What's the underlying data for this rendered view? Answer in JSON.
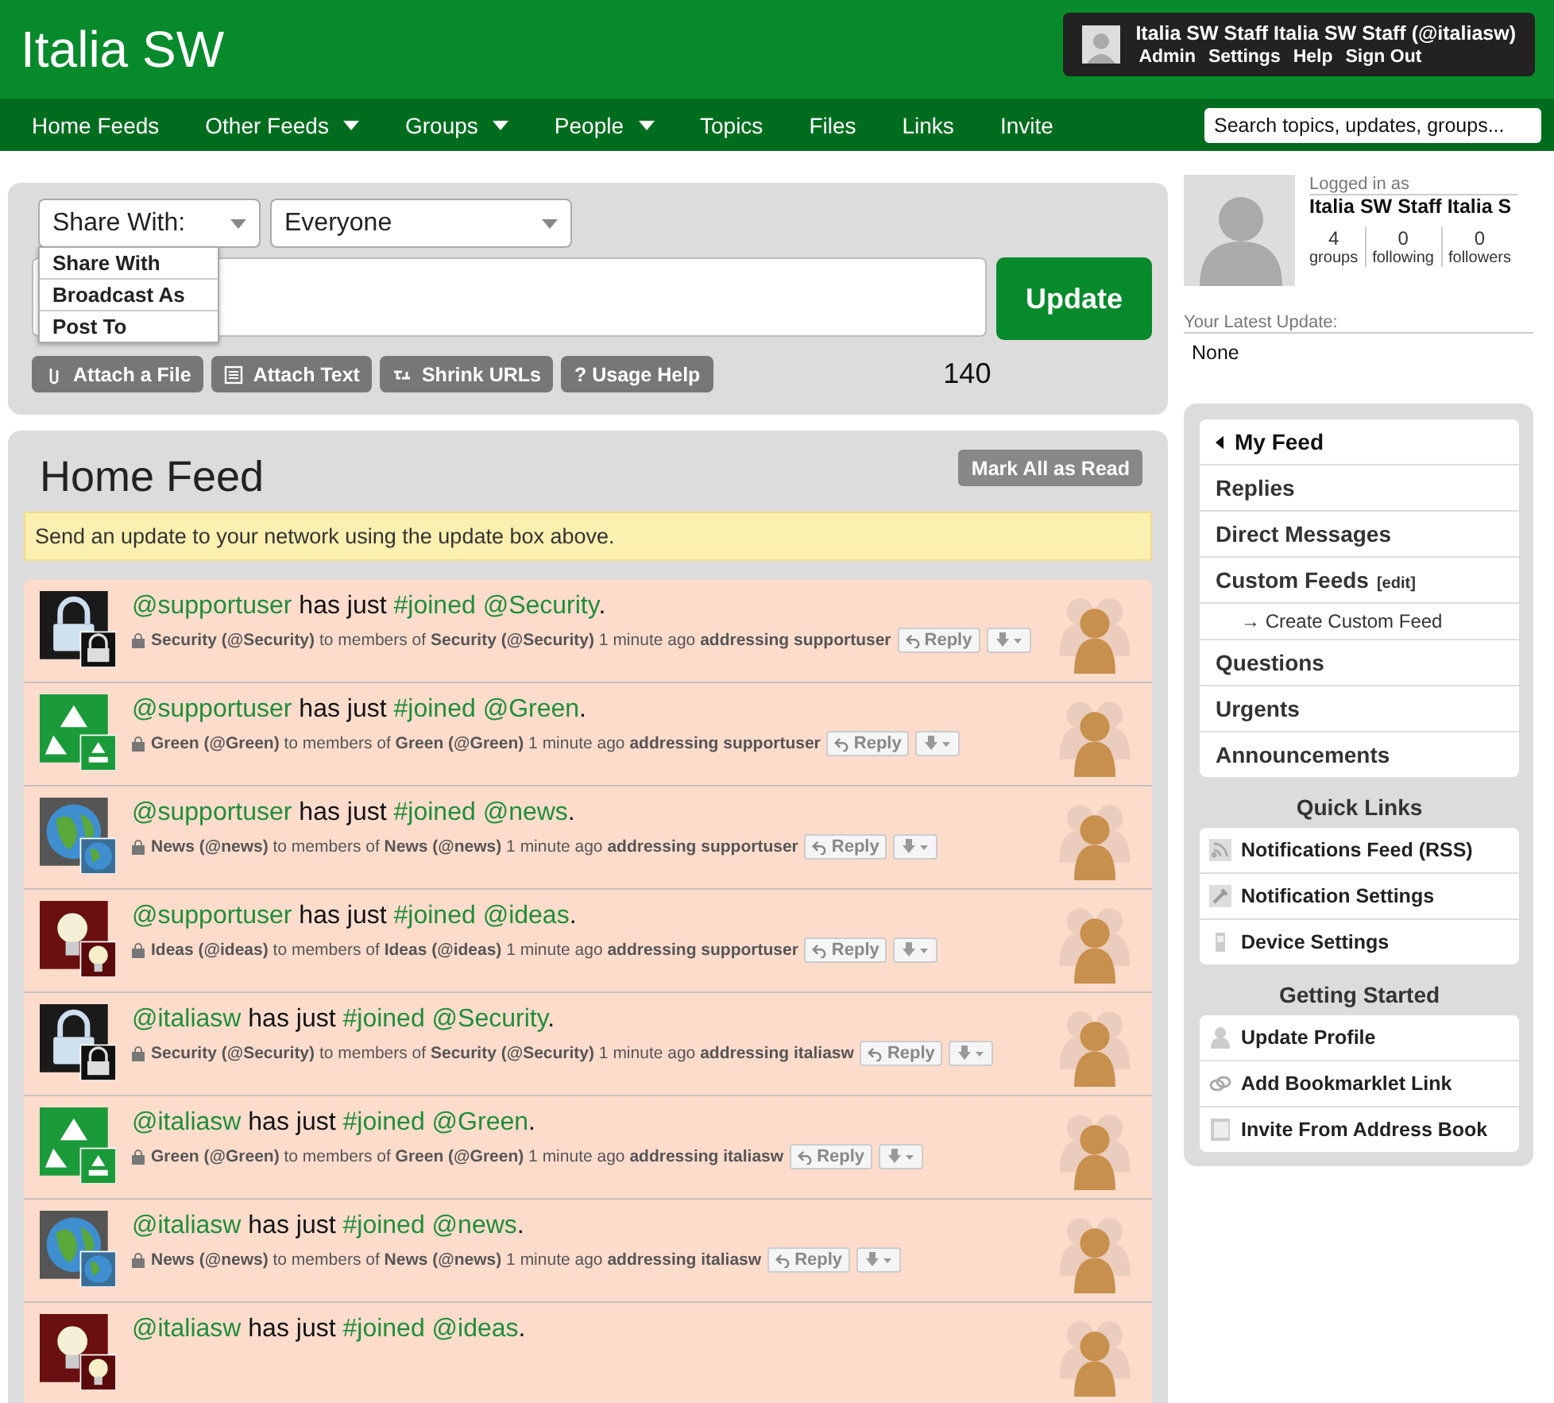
{
  "header": {
    "site_title": "Italia SW",
    "user": {
      "name": "Italia SW Staff Italia SW Staff (@italiasw)",
      "links": [
        "Admin",
        "Settings",
        "Help",
        "Sign Out"
      ]
    }
  },
  "nav": {
    "items": [
      {
        "label": "Home Feeds",
        "has_menu": false
      },
      {
        "label": "Other Feeds",
        "has_menu": true
      },
      {
        "label": "Groups",
        "has_menu": true
      },
      {
        "label": "People",
        "has_menu": true
      },
      {
        "label": "Topics",
        "has_menu": false
      },
      {
        "label": "Files",
        "has_menu": false
      },
      {
        "label": "Links",
        "has_menu": false
      },
      {
        "label": "Invite",
        "has_menu": false
      }
    ],
    "search": {
      "placeholder": "Search topics, updates, groups..."
    }
  },
  "composer": {
    "share_select": "Share With:",
    "audience_select": "Everyone",
    "menu": [
      "Share With",
      "Broadcast As",
      "Post To"
    ],
    "update_button": "Update",
    "tools": [
      {
        "label": "Attach a File",
        "kind": "file"
      },
      {
        "label": "Attach Text",
        "kind": "text"
      },
      {
        "label": "Shrink URLs",
        "kind": "link"
      },
      {
        "label": "? Usage Help",
        "kind": "help"
      }
    ],
    "counter": "140"
  },
  "feed": {
    "title": "Home Feed",
    "mark_read": "Mark All as Read",
    "notice": "Send an update to your network using the update box above.",
    "items": [
      {
        "kind": "security",
        "user": "@supportuser",
        "verb": "has just",
        "tag": "#joined",
        "group": "@Security",
        "end": ".",
        "from": "Security (@Security)",
        "to_prefix": "to members of",
        "to": "Security (@Security)",
        "time": "1 minute ago",
        "addressing": "addressing supportuser",
        "reply": "Reply"
      },
      {
        "kind": "green",
        "user": "@supportuser",
        "verb": "has just",
        "tag": "#joined",
        "group": "@Green",
        "end": ".",
        "from": "Green (@Green)",
        "to_prefix": "to members of",
        "to": "Green (@Green)",
        "time": "1 minute ago",
        "addressing": "addressing supportuser",
        "reply": "Reply"
      },
      {
        "kind": "news",
        "user": "@supportuser",
        "verb": "has just",
        "tag": "#joined",
        "group": "@news",
        "end": ".",
        "from": "News (@news)",
        "to_prefix": "to members of",
        "to": "News (@news)",
        "time": "1 minute ago",
        "addressing": "addressing supportuser",
        "reply": "Reply"
      },
      {
        "kind": "ideas",
        "user": "@supportuser",
        "verb": "has just",
        "tag": "#joined",
        "group": "@ideas",
        "end": ".",
        "from": "Ideas (@ideas)",
        "to_prefix": "to members of",
        "to": "Ideas (@ideas)",
        "time": "1 minute ago",
        "addressing": "addressing supportuser",
        "reply": "Reply"
      },
      {
        "kind": "security",
        "user": "@italiasw",
        "verb": "has just",
        "tag": "#joined",
        "group": "@Security",
        "end": ".",
        "from": "Security (@Security)",
        "to_prefix": "to members of",
        "to": "Security (@Security)",
        "time": "1 minute ago",
        "addressing": "addressing italiasw",
        "reply": "Reply"
      },
      {
        "kind": "green",
        "user": "@italiasw",
        "verb": "has just",
        "tag": "#joined",
        "group": "@Green",
        "end": ".",
        "from": "Green (@Green)",
        "to_prefix": "to members of",
        "to": "Green (@Green)",
        "time": "1 minute ago",
        "addressing": "addressing italiasw",
        "reply": "Reply"
      },
      {
        "kind": "news",
        "user": "@italiasw",
        "verb": "has just",
        "tag": "#joined",
        "group": "@news",
        "end": ".",
        "from": "News (@news)",
        "to_prefix": "to members of",
        "to": "News (@news)",
        "time": "1 minute ago",
        "addressing": "addressing italiasw",
        "reply": "Reply"
      },
      {
        "kind": "ideas",
        "user": "@italiasw",
        "verb": "has just",
        "tag": "#joined",
        "group": "@ideas",
        "end": "."
      }
    ]
  },
  "sidebar": {
    "profile": {
      "logged_in_label": "Logged in as",
      "name": "Italia SW Staff Italia S",
      "stats": [
        {
          "value": "4",
          "label": "groups"
        },
        {
          "value": "0",
          "label": "following"
        },
        {
          "value": "0",
          "label": "followers"
        }
      ]
    },
    "latest_update": {
      "label": "Your Latest Update:",
      "text": "None"
    },
    "feeds": [
      {
        "label": "My Feed",
        "selected": true
      },
      {
        "label": "Replies",
        "selected": false
      },
      {
        "label": "Direct Messages",
        "selected": false
      },
      {
        "label": "Custom Feeds",
        "edit": "[edit]",
        "selected": false,
        "children": [
          {
            "label": "→ Create Custom Feed",
            "selected": false
          }
        ]
      },
      {
        "label": "Questions",
        "selected": false
      },
      {
        "label": "Urgents",
        "selected": false
      },
      {
        "label": "Announcements",
        "selected": false
      }
    ],
    "quick_links": {
      "title": "Quick Links",
      "items": [
        {
          "label": "Notifications Feed (RSS)",
          "kind": "rss"
        },
        {
          "label": "Notification Settings",
          "kind": "settings"
        },
        {
          "label": "Device Settings",
          "kind": "device"
        }
      ]
    },
    "getting_started": {
      "title": "Getting Started",
      "items": [
        {
          "label": "Update Profile",
          "kind": "profile"
        },
        {
          "label": "Add Bookmarklet Link",
          "kind": "bookmarklet"
        },
        {
          "label": "Invite From Address Book",
          "kind": "addressbook"
        }
      ]
    }
  }
}
